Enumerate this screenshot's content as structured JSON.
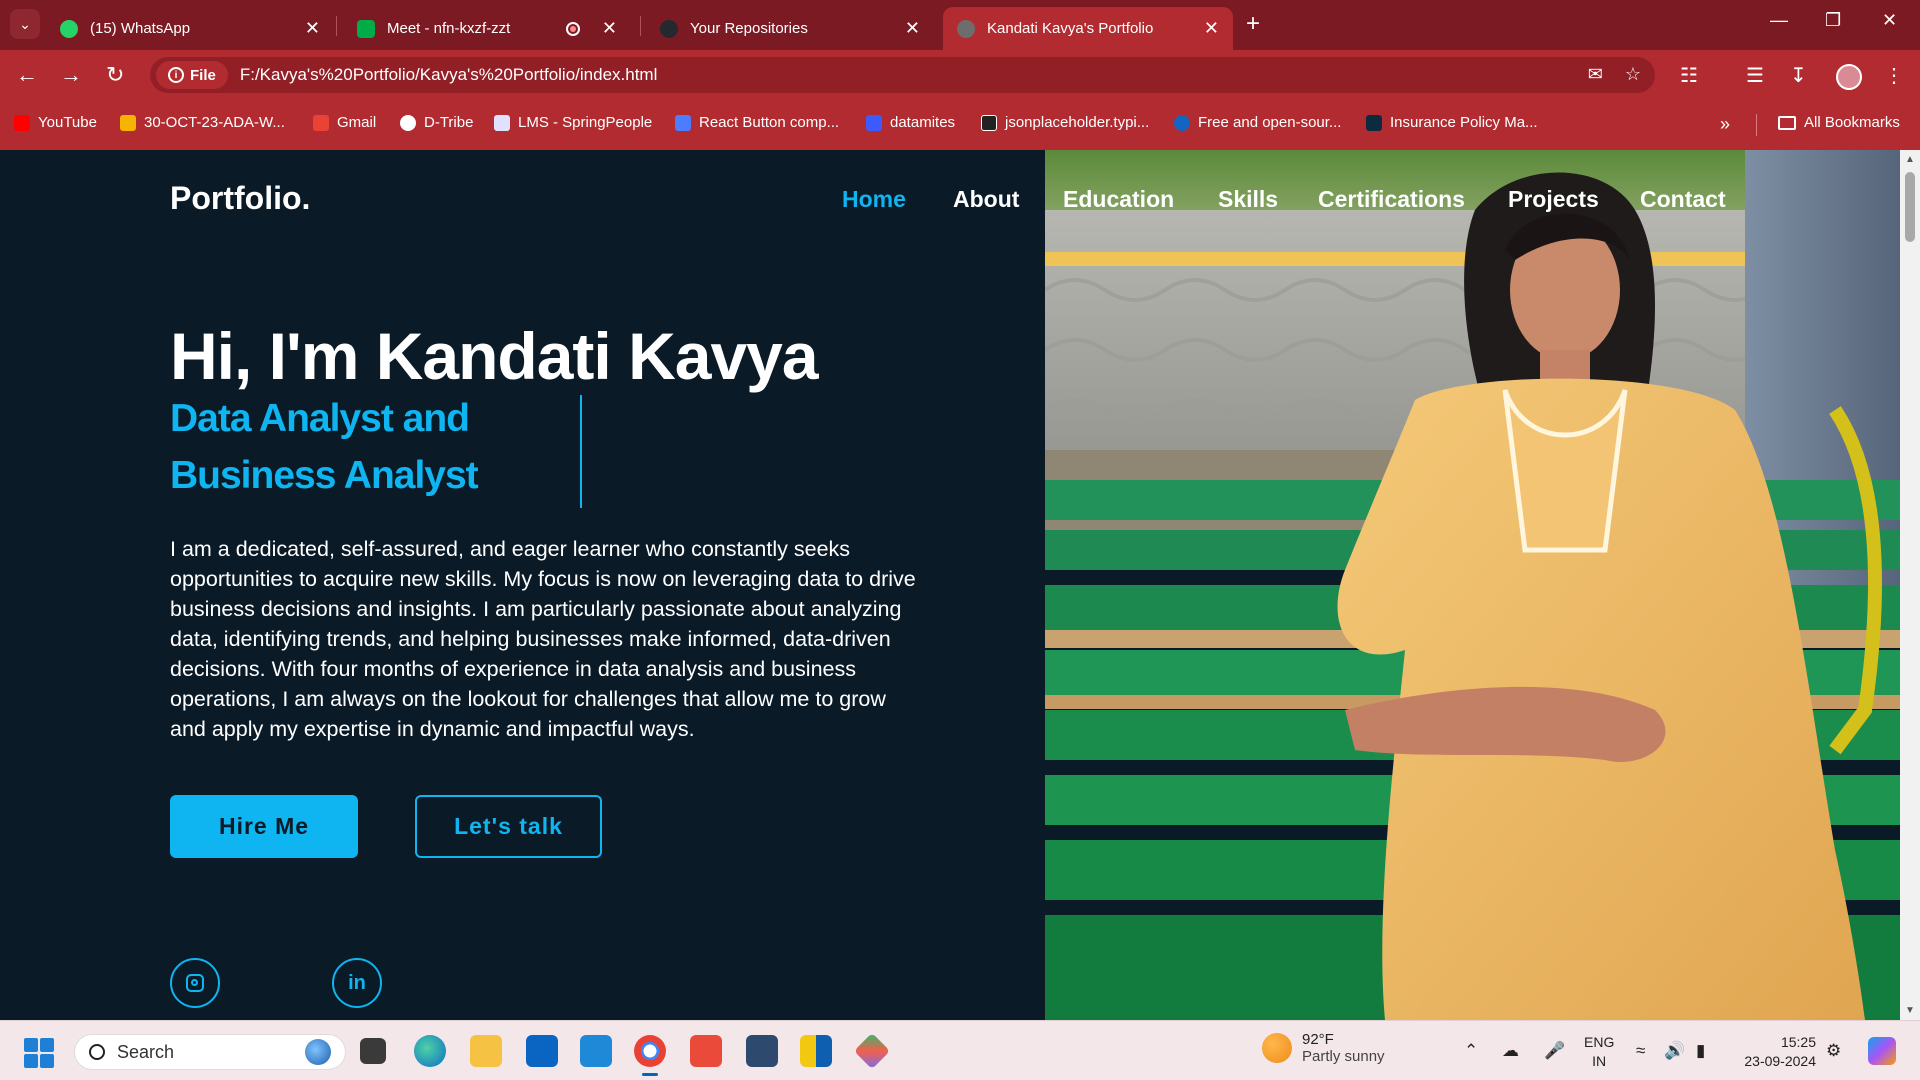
{
  "browser": {
    "tabs": [
      {
        "title": "(15) WhatsApp",
        "favicon_color": "#25d366"
      },
      {
        "title": "Meet - nfn-kxzf-zzt",
        "favicon_color": "#00ac47"
      },
      {
        "title": "Your Repositories",
        "favicon_color": "#24292f"
      },
      {
        "title": "Kandati Kavya's Portfolio",
        "favicon_color": "#6d6d6d"
      }
    ],
    "active_tab_index": 3,
    "file_chip": "File",
    "url": "F:/Kavya's%20Portfolio/Kavya's%20Portfolio/index.html",
    "bookmarks": [
      {
        "label": "YouTube",
        "color": "#ff0000"
      },
      {
        "label": "30-OCT-23-ADA-W...",
        "color": "#f4b400"
      },
      {
        "label": "Gmail",
        "color": "#ea4335"
      },
      {
        "label": "D-Tribe",
        "color": "#ffffff"
      },
      {
        "label": "LMS - SpringPeople",
        "color": "#e0e0ff"
      },
      {
        "label": "React Button comp...",
        "color": "#4e7cff"
      },
      {
        "label": "datamites",
        "color": "#3d5afe"
      },
      {
        "label": "jsonplaceholder.typi...",
        "color": "#222222"
      },
      {
        "label": "Free and open-sour...",
        "color": "#1565c0"
      },
      {
        "label": "Insurance Policy Ma...",
        "color": "#0d2b3e"
      }
    ],
    "all_bookmarks": "All Bookmarks"
  },
  "page": {
    "logo": "Portfolio.",
    "nav": [
      "Home",
      "About",
      "Education",
      "Skills",
      "Certifications",
      "Projects",
      "Contact"
    ],
    "nav_active": "Home",
    "greeting": "Hi, I'm Kandati Kavya",
    "role_line1": "Data Analyst and",
    "role_line2": "Business Analyst",
    "bio": "I am a dedicated, self-assured, and eager learner who constantly seeks opportunities to acquire new skills. My focus is now on leveraging data to drive business decisions and insights. I am particularly passionate about analyzing data, identifying trends, and helping businesses make informed, data-driven decisions. With four months of experience in data analysis and business operations, I am always on the lookout for challenges that allow me to grow and apply my expertise in dynamic and impactful ways.",
    "hire_button": "Hire Me",
    "talk_button": "Let's talk",
    "socials": [
      "instagram-icon",
      "linkedin-icon"
    ],
    "accent": "#0fb5f0",
    "background": "#0a1a27"
  },
  "taskbar": {
    "search_placeholder": "Search",
    "weather_temp": "92°F",
    "weather_desc": "Partly sunny",
    "lang_line1": "ENG",
    "lang_line2": "IN",
    "time": "15:25",
    "date": "23-09-2024"
  }
}
